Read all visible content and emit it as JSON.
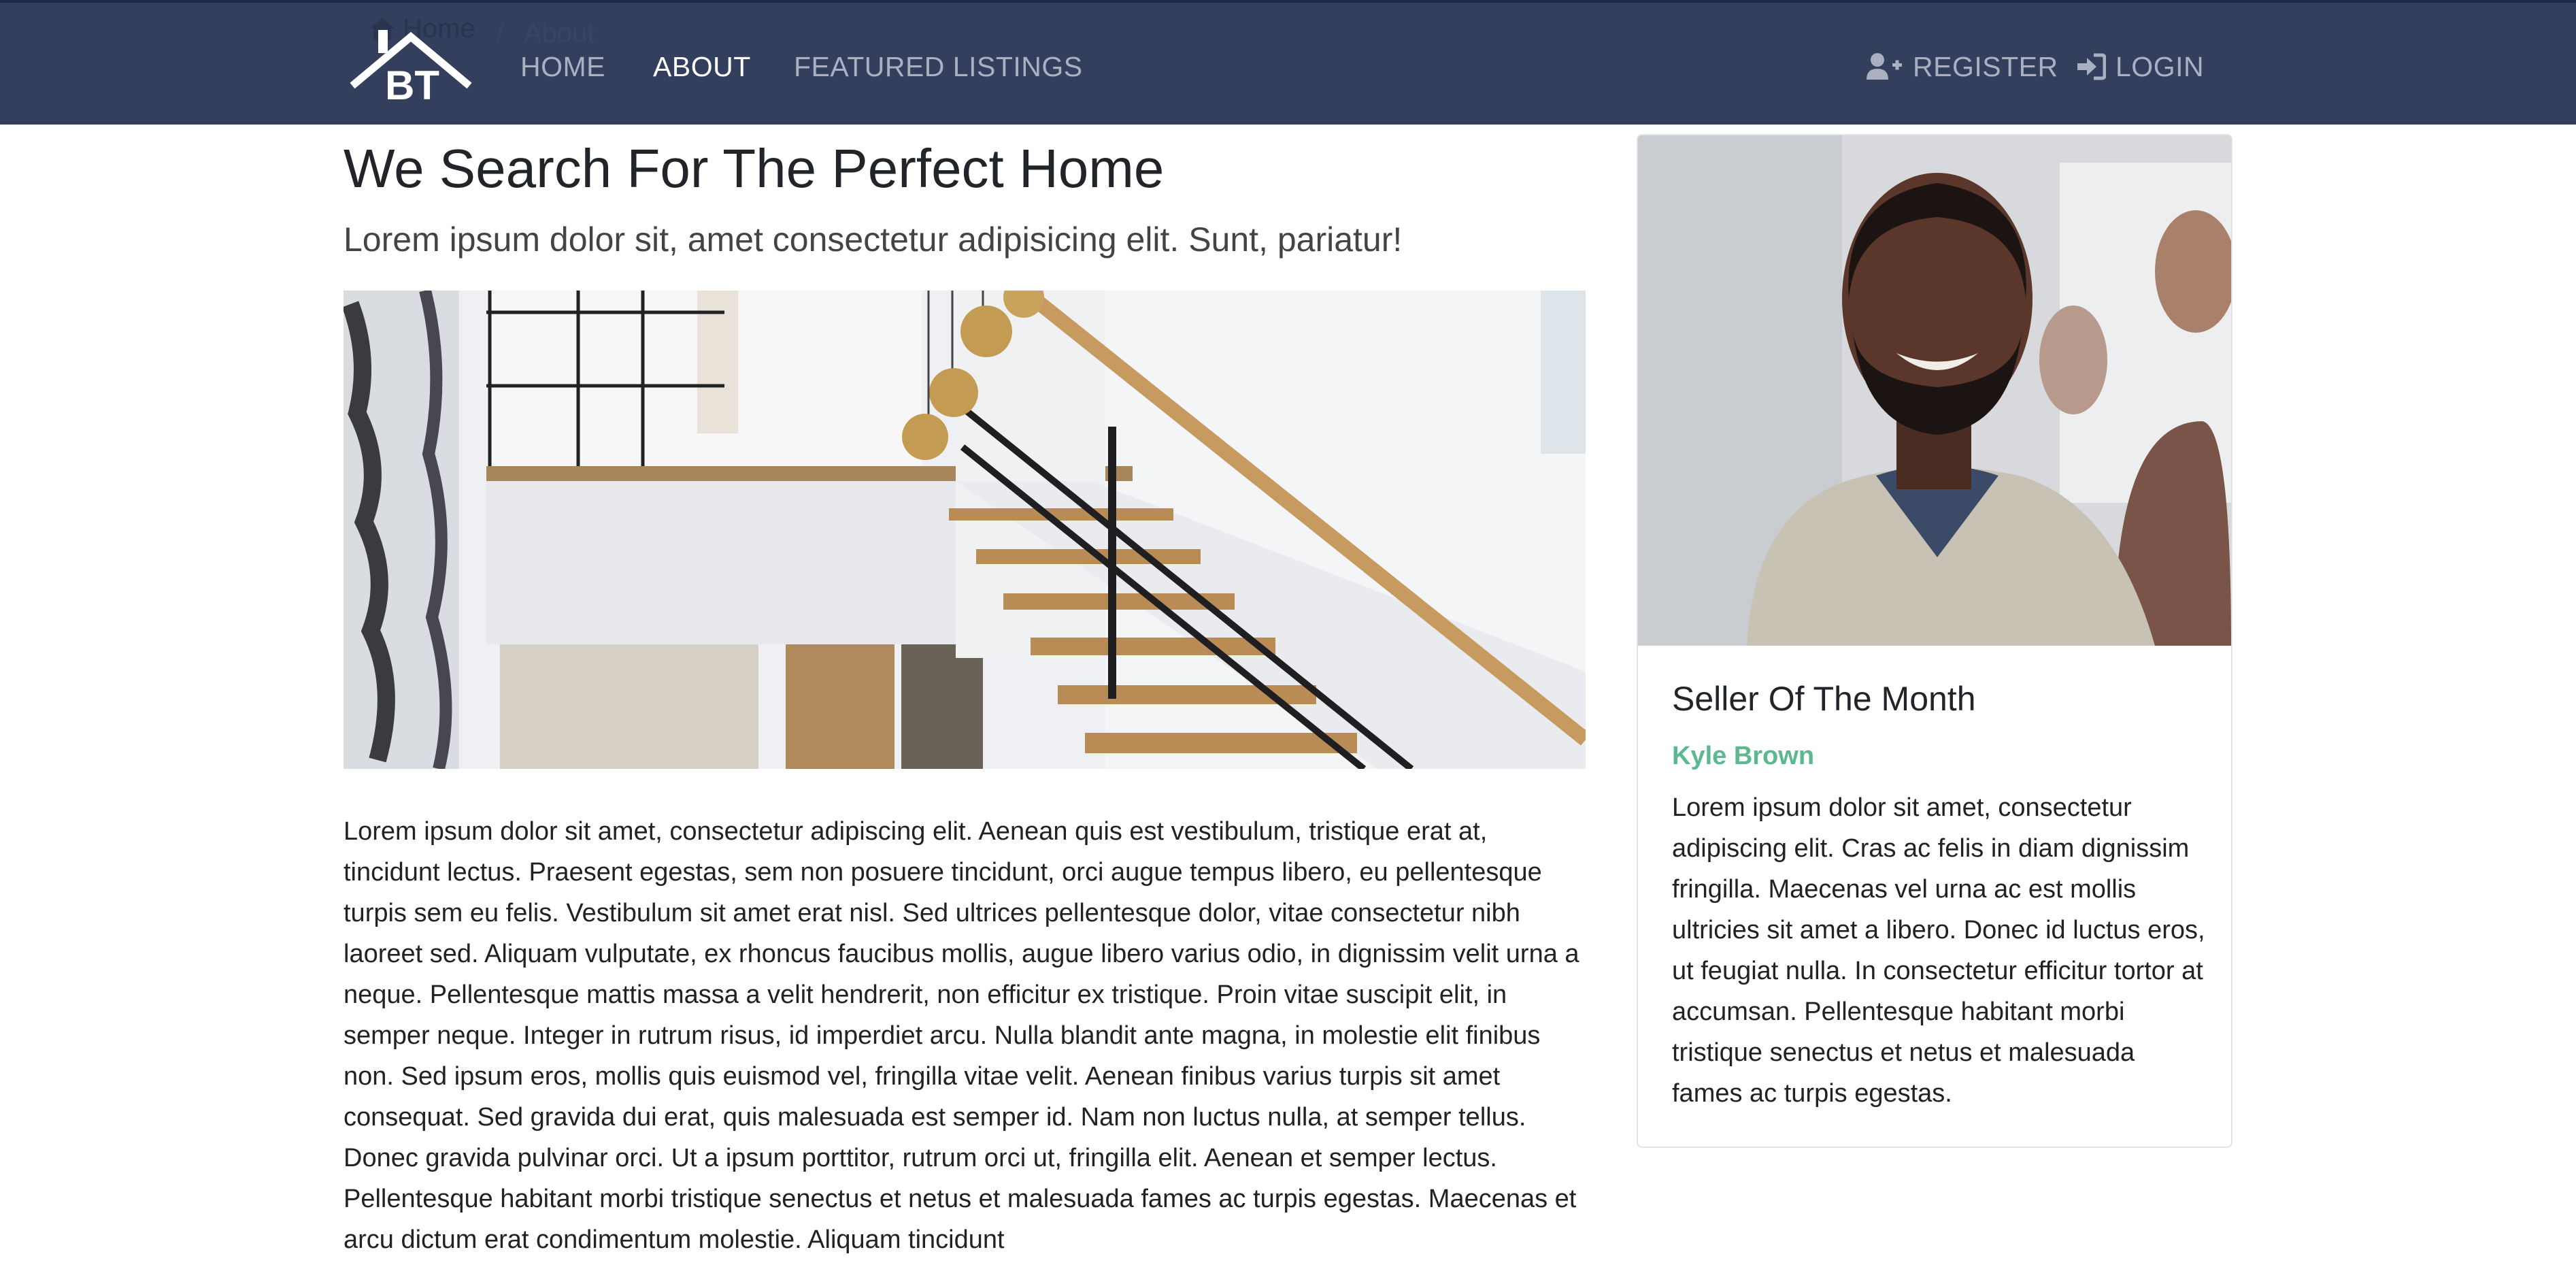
{
  "breadcrumb": {
    "home": "Home",
    "separator": "/",
    "current": "About"
  },
  "brand": {
    "logo_text": "BT"
  },
  "nav": {
    "home": "HOME",
    "about": "ABOUT",
    "featured": "FEATURED LISTINGS",
    "register": "REGISTER",
    "login": "LOGIN"
  },
  "main": {
    "title": "We Search For The Perfect Home",
    "lead": "Lorem ipsum dolor sit, amet consectetur adipisicing elit. Sunt, pariatur!",
    "body": "Lorem ipsum dolor sit amet, consectetur adipiscing elit. Aenean quis est vestibulum, tristique erat at, tincidunt lectus. Praesent egestas, sem non posuere tincidunt, orci augue tempus libero, eu pellentesque turpis sem eu felis. Vestibulum sit amet erat nisl. Sed ultrices pellentesque dolor, vitae consectetur nibh laoreet sed. Aliquam vulputate, ex rhoncus faucibus mollis, augue libero varius odio, in dignissim velit urna a neque. Pellentesque mattis massa a velit hendrerit, non efficitur ex tristique. Proin vitae suscipit elit, in semper neque. Integer in rutrum risus, id imperdiet arcu. Nulla blandit ante magna, in molestie elit finibus non. Sed ipsum eros, mollis quis euismod vel, fringilla vitae velit. Aenean finibus varius turpis sit amet consequat. Sed gravida dui erat, quis malesuada est semper id. Nam non luctus nulla, at semper tellus. Donec gravida pulvinar orci. Ut a ipsum porttitor, rutrum orci ut, fringilla elit. Aenean et semper lectus. Pellentesque habitant morbi tristique senectus et netus et malesuada fames ac turpis egestas. Maecenas et arcu dictum erat condimentum molestie. Aliquam tincidunt"
  },
  "card": {
    "title": "Seller Of The Month",
    "name": "Kyle Brown",
    "text": "Lorem ipsum dolor sit amet, consectetur adipiscing elit. Cras ac felis in diam dignissim fringilla. Maecenas vel urna ac est mollis ultricies sit amet a libero. Donec id luctus eros, ut feugiat nulla. In consectetur efficitur tortor at accumsan. Pellentesque habitant morbi tristique senectus et netus et malesuada fames ac turpis egestas."
  },
  "colors": {
    "navbar": "#343f5e",
    "nav_text": "#aab0bf",
    "nav_active": "#ffffff",
    "accent_green": "#5cb88e"
  },
  "icons": {
    "home": "home-icon",
    "register": "user-plus-icon",
    "login": "sign-in-icon"
  }
}
